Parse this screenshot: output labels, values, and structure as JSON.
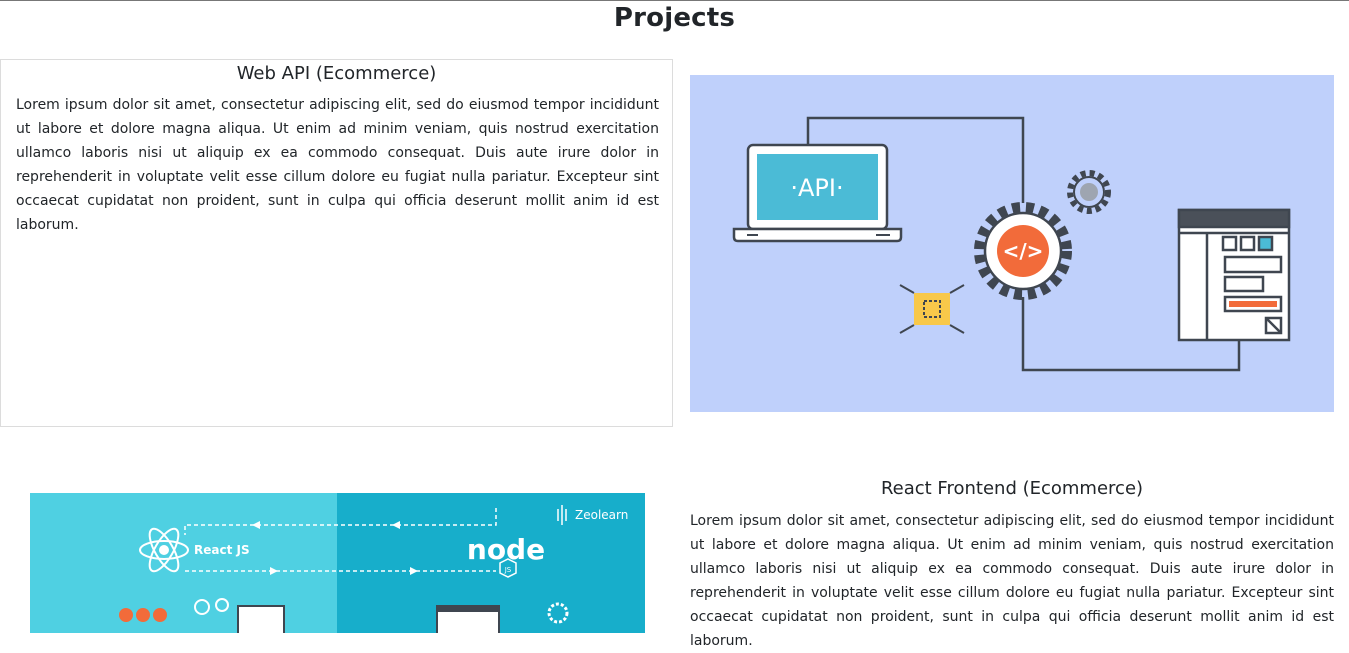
{
  "page": {
    "title": "Projects"
  },
  "projects": [
    {
      "title": "Web API (Ecommerce)",
      "description": "Lorem ipsum dolor sit amet, consectetur adipiscing elit, sed do eiusmod tempor incididunt ut labore et dolore magna aliqua. Ut enim ad minim veniam, quis nostrud exercitation ullamco laboris nisi ut aliquip ex ea commodo consequat. Duis aute irure dolor in reprehenderit in voluptate velit esse cillum dolore eu fugiat nulla pariatur. Excepteur sint occaecat cupidatat non proident, sunt in culpa qui officia deserunt mollit anim id est laborum.",
      "image": {
        "icon": "api-illustration",
        "screen_text": "·API·",
        "background": "#bfd0fb"
      }
    },
    {
      "title": "React Frontend (Ecommerce)",
      "description": "Lorem ipsum dolor sit amet, consectetur adipiscing elit, sed do eiusmod tempor incididunt ut labore et dolore magna aliqua. Ut enim ad minim veniam, quis nostrud exercitation ullamco laboris nisi ut aliquip ex ea commodo consequat. Duis aute irure dolor in reprehenderit in voluptate velit esse cillum dolore eu fugiat nulla pariatur. Excepteur sint occaecat cupidatat non proident, sunt in culpa qui officia deserunt mollit anim id est laborum.",
      "image": {
        "icon": "react-node-illustration",
        "brand": "Zeolearn",
        "left_label": "React JS",
        "right_label": "node",
        "right_badge": "JS"
      }
    }
  ],
  "colors": {
    "api_background": "#bfd0fb",
    "api_screen": "#4bbbd6",
    "api_gear_center": "#f26b3a",
    "api_chip": "#f8c84a",
    "react_left_background": "#4fd0e2",
    "react_right_background": "#17aecb"
  }
}
